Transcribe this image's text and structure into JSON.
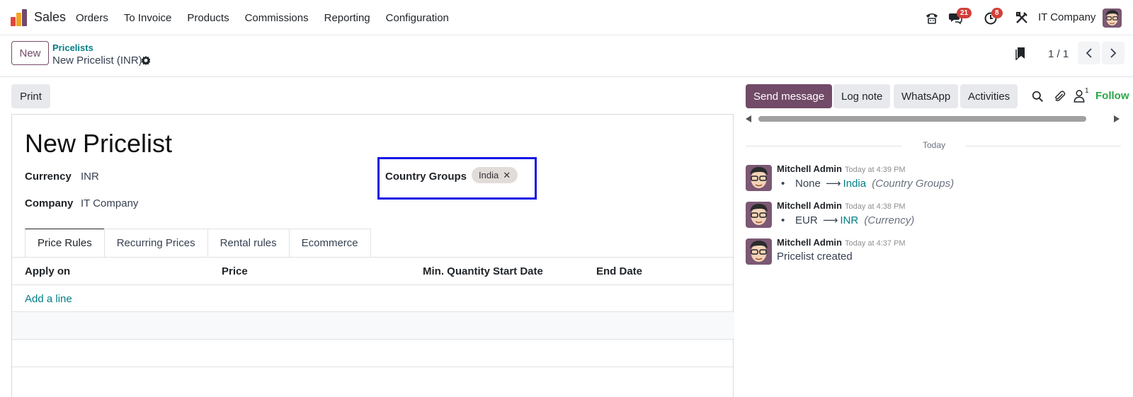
{
  "topnav": {
    "app_name": "Sales",
    "menu": [
      "Orders",
      "To Invoice",
      "Products",
      "Commissions",
      "Reporting",
      "Configuration"
    ],
    "messages_badge": "21",
    "activities_badge": "8",
    "company": "IT Company"
  },
  "control": {
    "new_label": "New",
    "breadcrumb_parent": "Pricelists",
    "breadcrumb_current": "New Pricelist (INR)",
    "pager": "1 / 1"
  },
  "print_label": "Print",
  "form": {
    "title": "New Pricelist",
    "currency_label": "Currency",
    "currency_value": "INR",
    "company_label": "Company",
    "company_value": "IT Company",
    "country_groups_label": "Country Groups",
    "country_group_tag": "India",
    "tabs": [
      "Price Rules",
      "Recurring Prices",
      "Rental rules",
      "Ecommerce"
    ],
    "columns": [
      "Apply on",
      "Price",
      "Min. Quantity",
      "Start Date",
      "End Date"
    ],
    "add_line": "Add a line"
  },
  "chatter": {
    "send_message": "Send message",
    "log_note": "Log note",
    "whatsapp": "WhatsApp",
    "activities": "Activities",
    "followers_count": "1",
    "follow_label": "Follow",
    "today_label": "Today",
    "messages": [
      {
        "author": "Mitchell Admin",
        "time": "Today at 4:39 PM",
        "old": "None",
        "new": "India",
        "field": "(Country Groups)"
      },
      {
        "author": "Mitchell Admin",
        "time": "Today at 4:38 PM",
        "old": "EUR",
        "new": "INR",
        "field": "(Currency)"
      },
      {
        "author": "Mitchell Admin",
        "time": "Today at 4:37 PM",
        "text": "Pricelist created"
      }
    ]
  },
  "colors": {
    "brand": "#714b67",
    "link": "#017e84",
    "badge": "#d23f3a",
    "highlight": "#1313e6"
  }
}
